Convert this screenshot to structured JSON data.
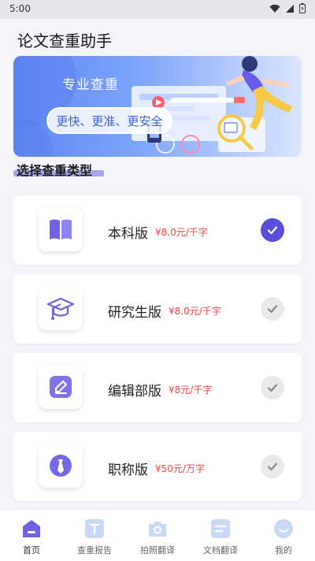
{
  "status": {
    "time": "5:00"
  },
  "app": {
    "title": "论文查重助手"
  },
  "banner": {
    "title": "专业查重",
    "slogan": "更快、更准、更安全"
  },
  "section": {
    "title": "选择查重类型"
  },
  "options": [
    {
      "name": "本科版",
      "price": "¥8.0元/千字",
      "selected": true,
      "icon": "book-icon"
    },
    {
      "name": "研究生版",
      "price": "¥8.0元/千字",
      "selected": false,
      "icon": "graduation-cap-icon"
    },
    {
      "name": "编辑部版",
      "price": "¥8元/千字",
      "selected": false,
      "icon": "edit-icon"
    },
    {
      "name": "职称版",
      "price": "¥50元/万字",
      "selected": false,
      "icon": "tie-icon"
    }
  ],
  "tabs": [
    {
      "label": "首页",
      "icon": "home-icon",
      "active": true
    },
    {
      "label": "查重报告",
      "icon": "report-icon",
      "active": false
    },
    {
      "label": "拍照翻译",
      "icon": "camera-icon",
      "active": false
    },
    {
      "label": "文档翻译",
      "icon": "document-icon",
      "active": false
    },
    {
      "label": "我的",
      "icon": "profile-icon",
      "active": false
    }
  ],
  "colors": {
    "accent": "#5b4fd9",
    "price": "#ef4848",
    "banner": "#6f96f7"
  }
}
